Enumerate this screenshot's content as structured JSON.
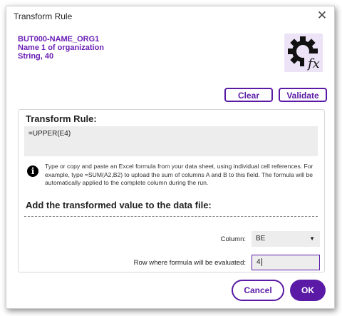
{
  "dialog": {
    "title": "Transform Rule",
    "close_icon": "close-icon",
    "field": {
      "name": "BUT000-NAME_ORG1",
      "description": "Name 1 of organization",
      "type": "String, 40"
    },
    "logo_icon": "gear-fx-icon"
  },
  "toolbar": {
    "clear_label": "Clear",
    "validate_label": "Validate"
  },
  "rule": {
    "heading": "Transform Rule:",
    "formula": "=UPPER(E4)",
    "info_icon": "info-icon",
    "info_text": "Type or copy and paste an Excel formula from your data sheet, using individual cell references. For example, type =SUM(A2,B2) to upload the sum of columns A and B to this field. The formula will be automatically applied to the complete column during the run."
  },
  "output": {
    "heading": "Add the transformed value to the data file:",
    "column_label": "Column:",
    "column_value": "BE",
    "row_label": "Row where formula will be evaluated:",
    "row_value": "4"
  },
  "footer": {
    "cancel_label": "Cancel",
    "ok_label": "OK"
  },
  "colors": {
    "accent": "#5a1aa6",
    "field_info": "#6a1fb5",
    "input_bg": "#ededed",
    "logo_bg": "#ece3f7"
  }
}
